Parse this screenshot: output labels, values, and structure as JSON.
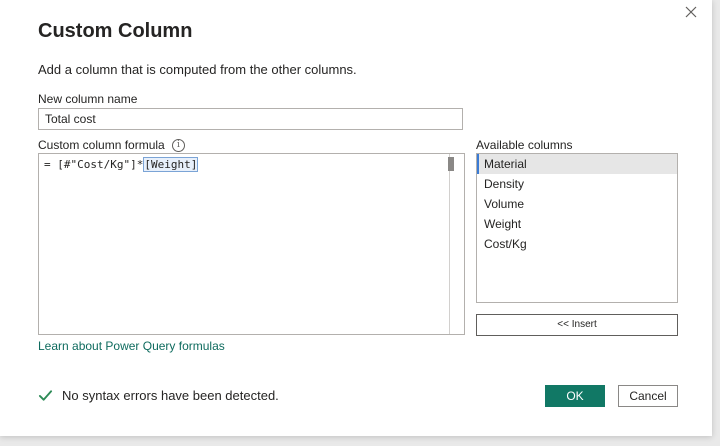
{
  "dialog": {
    "title": "Custom Column",
    "subtitle": "Add a column that is computed from the other columns."
  },
  "name_field": {
    "label": "New column name",
    "value": "Total cost"
  },
  "formula": {
    "label": "Custom column formula",
    "prefix": "= [#\"Cost/Kg\"]*",
    "highlighted": "[Weight]"
  },
  "available_columns": {
    "label": "Available columns",
    "items": [
      "Material",
      "Density",
      "Volume",
      "Weight",
      "Cost/Kg"
    ],
    "selected": "Material"
  },
  "insert_button": {
    "label": "<< Insert"
  },
  "learn_link": {
    "label": "Learn about Power Query formulas"
  },
  "status": {
    "text": "No syntax errors have been detected."
  },
  "buttons": {
    "ok": "OK",
    "cancel": "Cancel"
  },
  "colors": {
    "primary": "#117865",
    "link": "#0e6b5e",
    "check": "#2e8b57"
  }
}
